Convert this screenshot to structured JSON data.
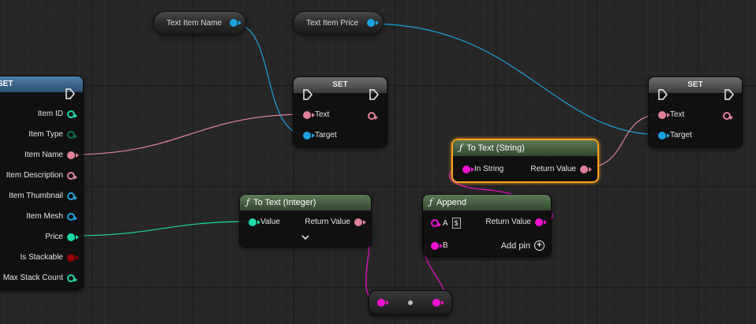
{
  "variables": {
    "text_item_name": "Text Item Name",
    "text_item_price": "Text Item Price"
  },
  "set_left": {
    "title": "SET",
    "pins": [
      "Item ID",
      "Item Type",
      "Item Name",
      "Item Description",
      "Item Thumbnail",
      "Item Mesh",
      "Price",
      "Is Stackable",
      "Max Stack Count"
    ]
  },
  "set_mid": {
    "title": "SET",
    "text_pin": "Text",
    "target_pin": "Target"
  },
  "set_right": {
    "title": "SET",
    "text_pin": "Text",
    "target_pin": "Target"
  },
  "to_text_string": {
    "title": "To Text (String)",
    "in_pin": "In String",
    "out_pin": "Return Value"
  },
  "to_text_integer": {
    "title": "To Text (Integer)",
    "in_pin": "Value",
    "out_pin": "Return Value"
  },
  "append": {
    "title": "Append",
    "a_pin": "A",
    "a_badge": "$",
    "b_pin": "B",
    "out_pin": "Return Value",
    "add_pin": "Add pin"
  },
  "colors": {
    "text_pin": "#e0819a",
    "object_pin": "#1aa3e0",
    "string_pin": "#f010d0",
    "int_pin": "#1ed9a8",
    "float_pin": "#1ed9a8",
    "bool_pin": "#950000",
    "name_pin": "#c8a0ff",
    "selection": "#f3a21c"
  }
}
